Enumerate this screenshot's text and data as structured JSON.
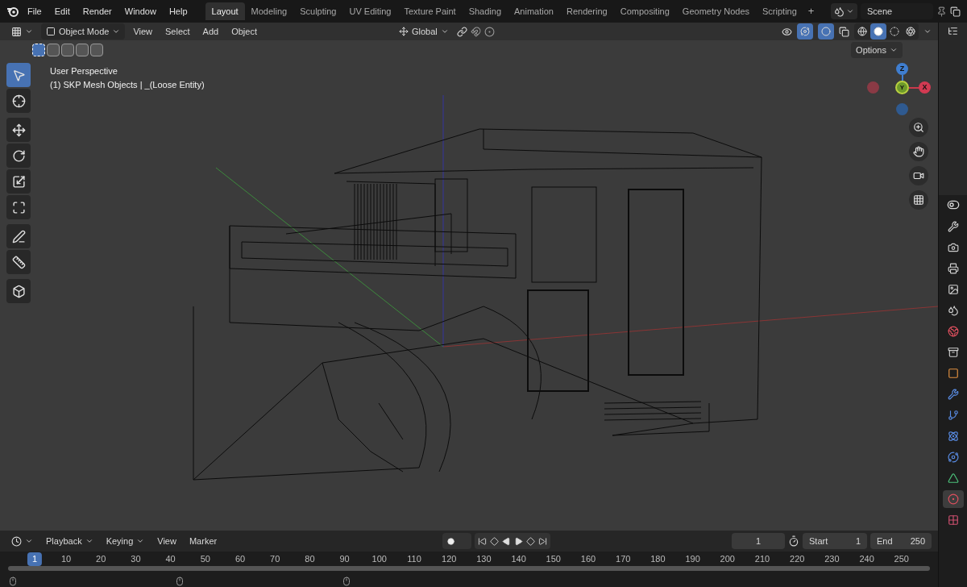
{
  "menu_bar": {
    "items": [
      "File",
      "Edit",
      "Render",
      "Window",
      "Help"
    ]
  },
  "workspace_tabs": [
    {
      "label": "Layout",
      "selected": true
    },
    {
      "label": "Modeling",
      "selected": false
    },
    {
      "label": "Sculpting",
      "selected": false
    },
    {
      "label": "UV Editing",
      "selected": false
    },
    {
      "label": "Texture Paint",
      "selected": false
    },
    {
      "label": "Shading",
      "selected": false
    },
    {
      "label": "Animation",
      "selected": false
    },
    {
      "label": "Rendering",
      "selected": false
    },
    {
      "label": "Compositing",
      "selected": false
    },
    {
      "label": "Geometry Nodes",
      "selected": false
    },
    {
      "label": "Scripting",
      "selected": false
    }
  ],
  "add_workspace": "+",
  "scene": {
    "name": "Scene"
  },
  "viewport": {
    "mode": "Object Mode",
    "menus": [
      "View",
      "Select",
      "Add",
      "Object"
    ],
    "orientation": "Global",
    "options": "Options",
    "select_modes": [
      {
        "selected": true
      },
      {
        "selected": false
      },
      {
        "selected": false
      },
      {
        "selected": false
      },
      {
        "selected": false
      }
    ],
    "shading": [
      {
        "kind": "wireframe",
        "selected": false
      },
      {
        "kind": "solid",
        "selected": true
      },
      {
        "kind": "material",
        "selected": false
      },
      {
        "kind": "rendered",
        "selected": false
      }
    ],
    "overlay_lines": [
      "User Perspective",
      "(1) SKP Mesh Objects | _(Loose Entity)"
    ],
    "tools": [
      {
        "kind": "select",
        "selected": true
      },
      {
        "kind": "cursor",
        "selected": false
      },
      {
        "kind": "move",
        "selected": false
      },
      {
        "kind": "rotate",
        "selected": false
      },
      {
        "kind": "scale",
        "selected": false
      },
      {
        "kind": "transform",
        "selected": false
      },
      {
        "kind": "annotate",
        "selected": false
      },
      {
        "kind": "measure",
        "selected": false
      },
      {
        "kind": "add-cube",
        "selected": false
      }
    ],
    "gizmo": {
      "z": "Z",
      "y": "Y",
      "x": "X"
    }
  },
  "properties_tabs": [
    {
      "kind": "tool",
      "selected": false
    },
    {
      "kind": "render",
      "selected": false
    },
    {
      "kind": "output",
      "selected": false
    },
    {
      "kind": "view-layer",
      "selected": false
    },
    {
      "kind": "scene",
      "selected": false
    },
    {
      "kind": "world",
      "selected": false
    },
    {
      "kind": "collection",
      "selected": false
    },
    {
      "kind": "object",
      "selected": false
    },
    {
      "kind": "modifier",
      "selected": false
    },
    {
      "kind": "particles",
      "selected": false
    },
    {
      "kind": "physics",
      "selected": false
    },
    {
      "kind": "constraints",
      "selected": false
    },
    {
      "kind": "data",
      "selected": false
    },
    {
      "kind": "material",
      "selected": true
    },
    {
      "kind": "texture",
      "selected": false
    }
  ],
  "timeline": {
    "menus": [
      {
        "label": "Playback",
        "dropdown": true
      },
      {
        "label": "Keying",
        "dropdown": true
      },
      {
        "label": "View",
        "dropdown": false
      },
      {
        "label": "Marker",
        "dropdown": false
      }
    ],
    "current_frame": "1",
    "start_label": "Start",
    "start": "1",
    "end_label": "End",
    "end": "250",
    "ruler": [
      {
        "label": "1",
        "current": true
      },
      {
        "label": "10",
        "current": false
      },
      {
        "label": "20",
        "current": false
      },
      {
        "label": "30",
        "current": false
      },
      {
        "label": "40",
        "current": false
      },
      {
        "label": "50",
        "current": false
      },
      {
        "label": "60",
        "current": false
      },
      {
        "label": "70",
        "current": false
      },
      {
        "label": "80",
        "current": false
      },
      {
        "label": "90",
        "current": false
      },
      {
        "label": "100",
        "current": false
      },
      {
        "label": "110",
        "current": false
      },
      {
        "label": "120",
        "current": false
      },
      {
        "label": "130",
        "current": false
      },
      {
        "label": "140",
        "current": false
      },
      {
        "label": "150",
        "current": false
      },
      {
        "label": "160",
        "current": false
      },
      {
        "label": "170",
        "current": false
      },
      {
        "label": "180",
        "current": false
      },
      {
        "label": "190",
        "current": false
      },
      {
        "label": "200",
        "current": false
      },
      {
        "label": "210",
        "current": false
      },
      {
        "label": "220",
        "current": false
      },
      {
        "label": "230",
        "current": false
      },
      {
        "label": "240",
        "current": false
      },
      {
        "label": "250",
        "current": false
      }
    ]
  }
}
